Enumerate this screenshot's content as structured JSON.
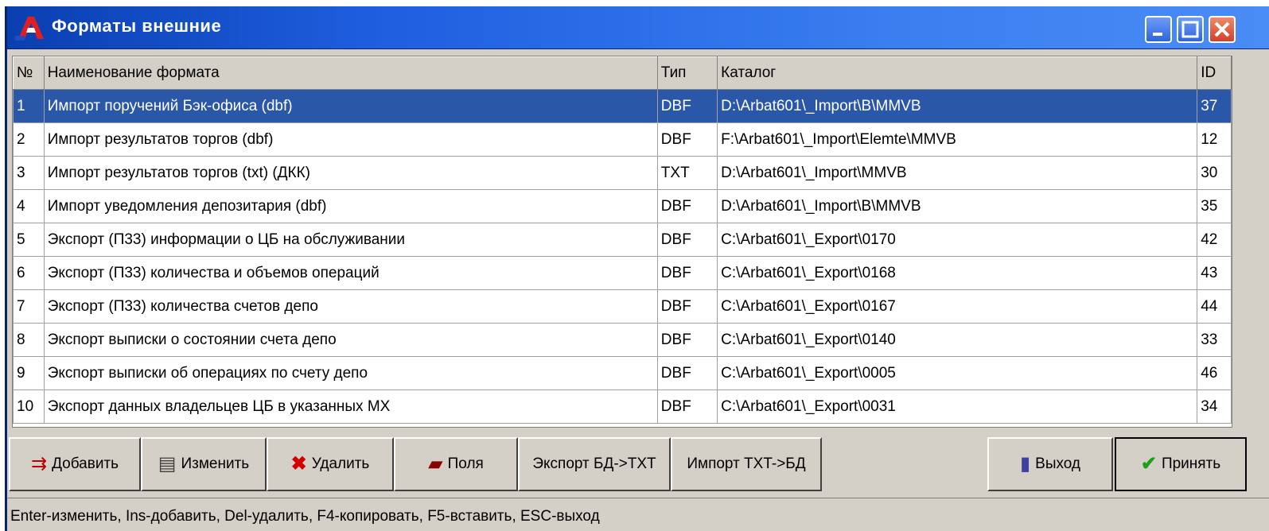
{
  "window": {
    "title": "Форматы внешние"
  },
  "table": {
    "headers": [
      "№",
      "Наименование формата",
      "Тип",
      "Каталог",
      "ID"
    ],
    "rows": [
      {
        "num": "1",
        "name": "Импорт поручений Бэк-офиса (dbf)",
        "type": "DBF",
        "catalog": "D:\\Arbat601\\_Import\\B\\MMVB",
        "id": "37"
      },
      {
        "num": "2",
        "name": "Импорт результатов торгов (dbf)",
        "type": "DBF",
        "catalog": "F:\\Arbat601\\_Import\\Elemte\\MMVB",
        "id": "12"
      },
      {
        "num": "3",
        "name": "Импорт результатов торгов (txt) (ДКК)",
        "type": "TXT",
        "catalog": "D:\\Arbat601\\_Import\\MMVB",
        "id": "30"
      },
      {
        "num": "4",
        "name": "Импорт уведомления депозитария (dbf)",
        "type": "DBF",
        "catalog": "D:\\Arbat601\\_Import\\B\\MMVB",
        "id": "35"
      },
      {
        "num": "5",
        "name": "Экспорт (П33) информации о ЦБ на обслуживании",
        "type": "DBF",
        "catalog": "C:\\Arbat601\\_Export\\0170",
        "id": "42"
      },
      {
        "num": "6",
        "name": "Экспорт (П33) количества и объемов операций",
        "type": "DBF",
        "catalog": "C:\\Arbat601\\_Export\\0168",
        "id": "43"
      },
      {
        "num": "7",
        "name": "Экспорт (П33) количества счетов депо",
        "type": "DBF",
        "catalog": "C:\\Arbat601\\_Export\\0167",
        "id": "44"
      },
      {
        "num": "8",
        "name": "Экспорт выписки о состоянии счета депо",
        "type": "DBF",
        "catalog": "C:\\Arbat601\\_Export\\0140",
        "id": "33"
      },
      {
        "num": "9",
        "name": "Экспорт выписки об операциях по счету депо",
        "type": "DBF",
        "catalog": "C:\\Arbat601\\_Export\\0005",
        "id": "46"
      },
      {
        "num": "10",
        "name": "Экспорт данных владельцев ЦБ в указанных МХ",
        "type": "DBF",
        "catalog": "C:\\Arbat601\\_Export\\0031",
        "id": "34"
      }
    ],
    "selected_index": 0
  },
  "toolbar": {
    "add_label": "Добавить",
    "edit_label": "Изменить",
    "delete_label": "Удалить",
    "fields_label": "Поля",
    "export_label": "Экспорт БД->TXT",
    "import_label": "Импорт TXT->БД",
    "exit_label": "Выход",
    "accept_label": "Принять"
  },
  "status_bar": {
    "text": "Enter-изменить, Ins-добавить, Del-удалить, F4-копировать, F5-вставить, ESC-выход"
  },
  "colors": {
    "selection": "#2b57a8",
    "titlebar": "#1f5fe0",
    "face": "#d4d0c8"
  }
}
